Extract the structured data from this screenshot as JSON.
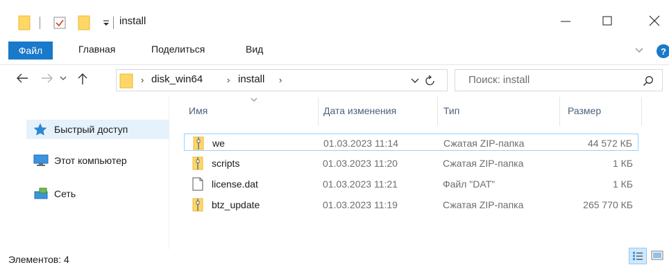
{
  "window": {
    "title": "install",
    "minimize_label": "—",
    "close_label": "✕"
  },
  "ribbon": {
    "tabs": [
      "Файл",
      "Главная",
      "Поделиться",
      "Вид"
    ],
    "help_label": "?"
  },
  "address": {
    "crumbs": [
      "disk_win64",
      "install"
    ],
    "separator": "›"
  },
  "search": {
    "placeholder": "Поиск: install"
  },
  "nav": {
    "items": [
      {
        "label": "Быстрый доступ",
        "icon": "star-icon",
        "selected": true
      },
      {
        "label": "Этот компьютер",
        "icon": "computer-icon",
        "selected": false
      },
      {
        "label": "Сеть",
        "icon": "network-icon",
        "selected": false
      }
    ]
  },
  "columns": [
    "Имя",
    "Дата изменения",
    "Тип",
    "Размер"
  ],
  "files": [
    {
      "name": "we",
      "date": "01.03.2023 11:14",
      "type": "Сжатая ZIP-папка",
      "size": "44 572 КБ",
      "icon": "zip-folder-icon",
      "selected": true
    },
    {
      "name": "scripts",
      "date": "01.03.2023 11:20",
      "type": "Сжатая ZIP-папка",
      "size": "1 КБ",
      "icon": "zip-folder-icon",
      "selected": false
    },
    {
      "name": "license.dat",
      "date": "01.03.2023 11:21",
      "type": "Файл \"DAT\"",
      "size": "1 КБ",
      "icon": "file-icon",
      "selected": false
    },
    {
      "name": "btz_update",
      "date": "01.03.2023 11:19",
      "type": "Сжатая ZIP-папка",
      "size": "265 770 КБ",
      "icon": "zip-folder-icon",
      "selected": false
    }
  ],
  "status": {
    "text": "Элементов: 4"
  },
  "colors": {
    "accent": "#1979ca",
    "folder": "#ffd767",
    "selection_border": "#99d1ff",
    "selection_bg": "#e5f1fb",
    "header_text": "#4c607a"
  }
}
